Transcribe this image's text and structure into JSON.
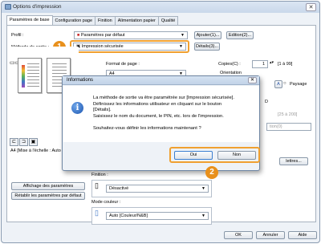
{
  "window": {
    "title": "Options d'impression",
    "close": "✕"
  },
  "tabs": [
    "Paramètres de base",
    "Configuration page",
    "Finition",
    "Alimentation papier",
    "Qualité"
  ],
  "profile": {
    "label": "Profil :",
    "value": "Paramètres par défaut",
    "add": "Ajouter(1)...",
    "edit": "Edition(2)..."
  },
  "output": {
    "label": "Méthode de sortie :",
    "value": "Impression sécurisée",
    "details": "Détails(3)..."
  },
  "format": {
    "label": "Format de page :",
    "value": "A4"
  },
  "copies": {
    "label": "Copies(C) :",
    "value": "1",
    "range": "[1 à 99]"
  },
  "orientation": {
    "label": "Orientation",
    "option": "Paysage",
    "option_letter": "A"
  },
  "partial": {
    "zoom_range": "[25 à 200]",
    "layout_frag": "tion(0)",
    "d_frag": "D",
    "text_frag": "lettres...",
    "media_label": "A4 [Mise à l'échelle : Auto"
  },
  "finishing": {
    "label": "Finition :",
    "value": "Désactivé"
  },
  "color_mode": {
    "label": "Mode couleur :",
    "value": "Auto [Couleur/N&B]"
  },
  "left_buttons": {
    "show_settings": "Affichage des paramètres",
    "restore": "Rétablir les paramètres par défaut"
  },
  "bottom_buttons": {
    "ok": "OK",
    "cancel": "Annuler",
    "help": "Aide"
  },
  "dialog": {
    "title": "Informations",
    "close": "✕",
    "icon_glyph": "i",
    "lines": [
      "La méthode de sortie va être paramétrée sur [Impression sécurisée].",
      "Définissez les informations utilisateur en cliquant sur le bouton",
      "[Détails].",
      "Saisissez le nom du document, le PIN, etc. lors de l'impression."
    ],
    "question": "Souhaitez-vous définir les informations maintenant ?",
    "yes": "Oui",
    "no": "Non"
  },
  "callouts": [
    "1",
    "2"
  ],
  "colors": {
    "callout": "#e8901c",
    "highlight": "#f0a030"
  }
}
